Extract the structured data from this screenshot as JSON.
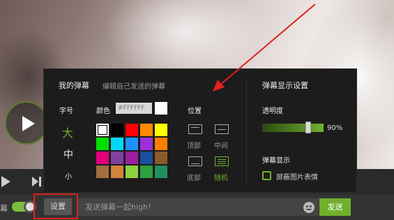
{
  "panel": {
    "title": "我的弹幕",
    "subtitle": "编辑自己发送的弹幕",
    "font_size_label": "字号",
    "font_sizes": [
      "大",
      "中",
      "小"
    ],
    "color_label": "颜色",
    "color_hex_value": "#FFFFFF",
    "position_label": "位置",
    "positions": [
      "顶部",
      "中间",
      "底部",
      "随机"
    ],
    "display_settings_title": "弹幕显示设置",
    "opacity_label": "透明度",
    "opacity_value": "90%",
    "opacity_level": 0.9,
    "danmu_display_label": "弹幕显示",
    "block_image_label": "屏蔽图片表情"
  },
  "palette": [
    [
      "#ffffff",
      "#000000",
      "#ff0000",
      "#ff8c00",
      "#ffff00"
    ],
    [
      "#00e000",
      "#00d8f8",
      "#1e90ff",
      "#9b30d8",
      "#ff7f00"
    ],
    [
      "#e0007a",
      "#8040a0",
      "#9c1f9c",
      "#1c4fa0",
      "#8b5a2b"
    ],
    [
      "#a0703c",
      "#d0843c",
      "#8fd040",
      "#2ea040",
      "#1e9060"
    ]
  ],
  "controls": {
    "danmu_label": "幕",
    "settings_button": "设置",
    "input_placeholder": "发送弹幕一起high！",
    "send_button": "发送"
  },
  "colors": {
    "accent": "#6fb02c",
    "highlight": "#e02020"
  }
}
